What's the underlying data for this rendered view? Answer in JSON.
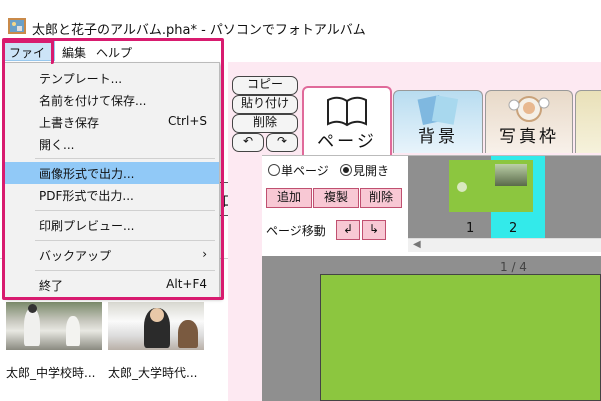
{
  "window": {
    "title": "太郎と花子のアルバム.pha* - パソコンでフォトアルバム"
  },
  "menubar": {
    "items": [
      "ファイル",
      "編集",
      "ヘルプ"
    ]
  },
  "file_menu": {
    "items": [
      {
        "label": "テンプレート...",
        "shortcut": ""
      },
      {
        "label": "名前を付けて保存...",
        "shortcut": ""
      },
      {
        "label": "上書き保存",
        "shortcut": "Ctrl+S"
      },
      {
        "label": "開く...",
        "shortcut": ""
      },
      {
        "label": "画像形式で出力...",
        "shortcut": "",
        "highlighted": true
      },
      {
        "label": "PDF形式で出力...",
        "shortcut": ""
      },
      {
        "label": "印刷プレビュー...",
        "shortcut": ""
      },
      {
        "label": "バックアップ",
        "shortcut": "",
        "submenu_arrow": "›"
      },
      {
        "label": "終了",
        "shortcut": "Alt+F4"
      }
    ]
  },
  "left_panel": {
    "partial_char": "大",
    "thumbnails": [
      {
        "caption": "太郎_中学校時..."
      },
      {
        "caption": "太郎_大学時代..."
      }
    ]
  },
  "edit_buttons": {
    "copy": "コピー",
    "paste": "貼り付け",
    "delete": "削除",
    "undo": "↶",
    "redo": "↷"
  },
  "tabs": [
    {
      "label": "ページ",
      "active": true
    },
    {
      "label": "背景"
    },
    {
      "label": "写真枠"
    }
  ],
  "page_panel": {
    "single_page": "単ページ",
    "spread": "見開き",
    "add": "追加",
    "duplicate": "複製",
    "delete": "削除",
    "page_move": "ページ移動",
    "move_left": "↲",
    "move_right": "↳",
    "page_numbers": [
      "1",
      "2"
    ],
    "page_counter": "1 / 4"
  },
  "colors": {
    "accent_highlight": "#d81b6f",
    "menu_highlight": "#91c9f7",
    "page_green": "#8cc63f",
    "selected_page": "#33eaea"
  }
}
